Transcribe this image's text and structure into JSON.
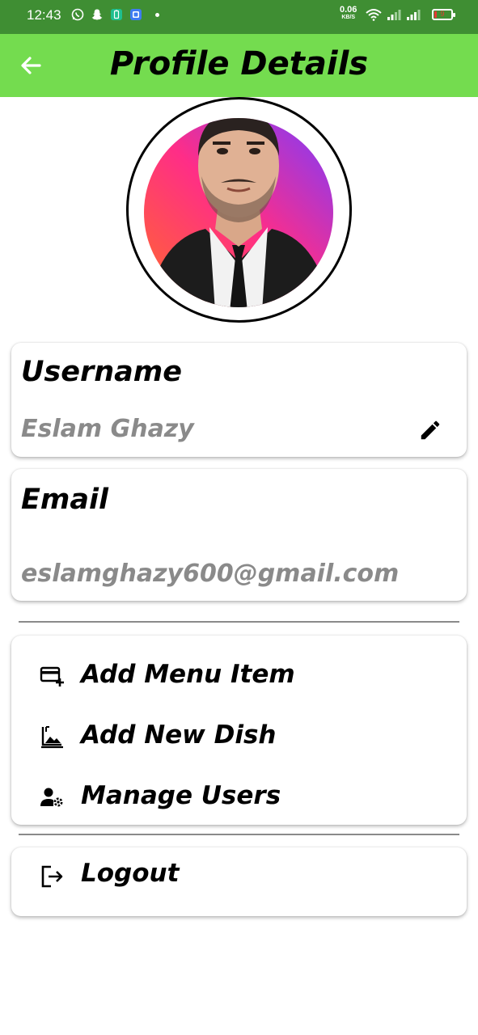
{
  "status_bar": {
    "time": "12:43",
    "net_speed": "0.06",
    "net_unit": "KB/S",
    "battery": "9",
    "icons": [
      "whatsapp-icon",
      "snapchat-icon",
      "battery-saver-icon",
      "app-icon",
      "wifi-icon",
      "signal-icon",
      "signal-icon",
      "battery-icon"
    ]
  },
  "app_bar": {
    "title": "Profile Details",
    "back_icon": "arrow-left-icon",
    "background_color": "#74dc4f"
  },
  "profile": {
    "avatar_colors": [
      "#ff2d87",
      "#ff6a2b",
      "#7b3cff"
    ]
  },
  "username_card": {
    "label": "Username",
    "value": "Eslam Ghazy",
    "edit_icon": "pencil-icon"
  },
  "email_card": {
    "label": "Email",
    "value": "eslamghazy600@gmail.com"
  },
  "menu": {
    "items": [
      {
        "label": "Add Menu Item",
        "icon": "card-plus-icon"
      },
      {
        "label": "Add New Dish",
        "icon": "dish-image-icon"
      },
      {
        "label": "Manage Users",
        "icon": "manage-users-icon"
      }
    ]
  },
  "logout": {
    "label": "Logout",
    "icon": "logout-icon"
  }
}
